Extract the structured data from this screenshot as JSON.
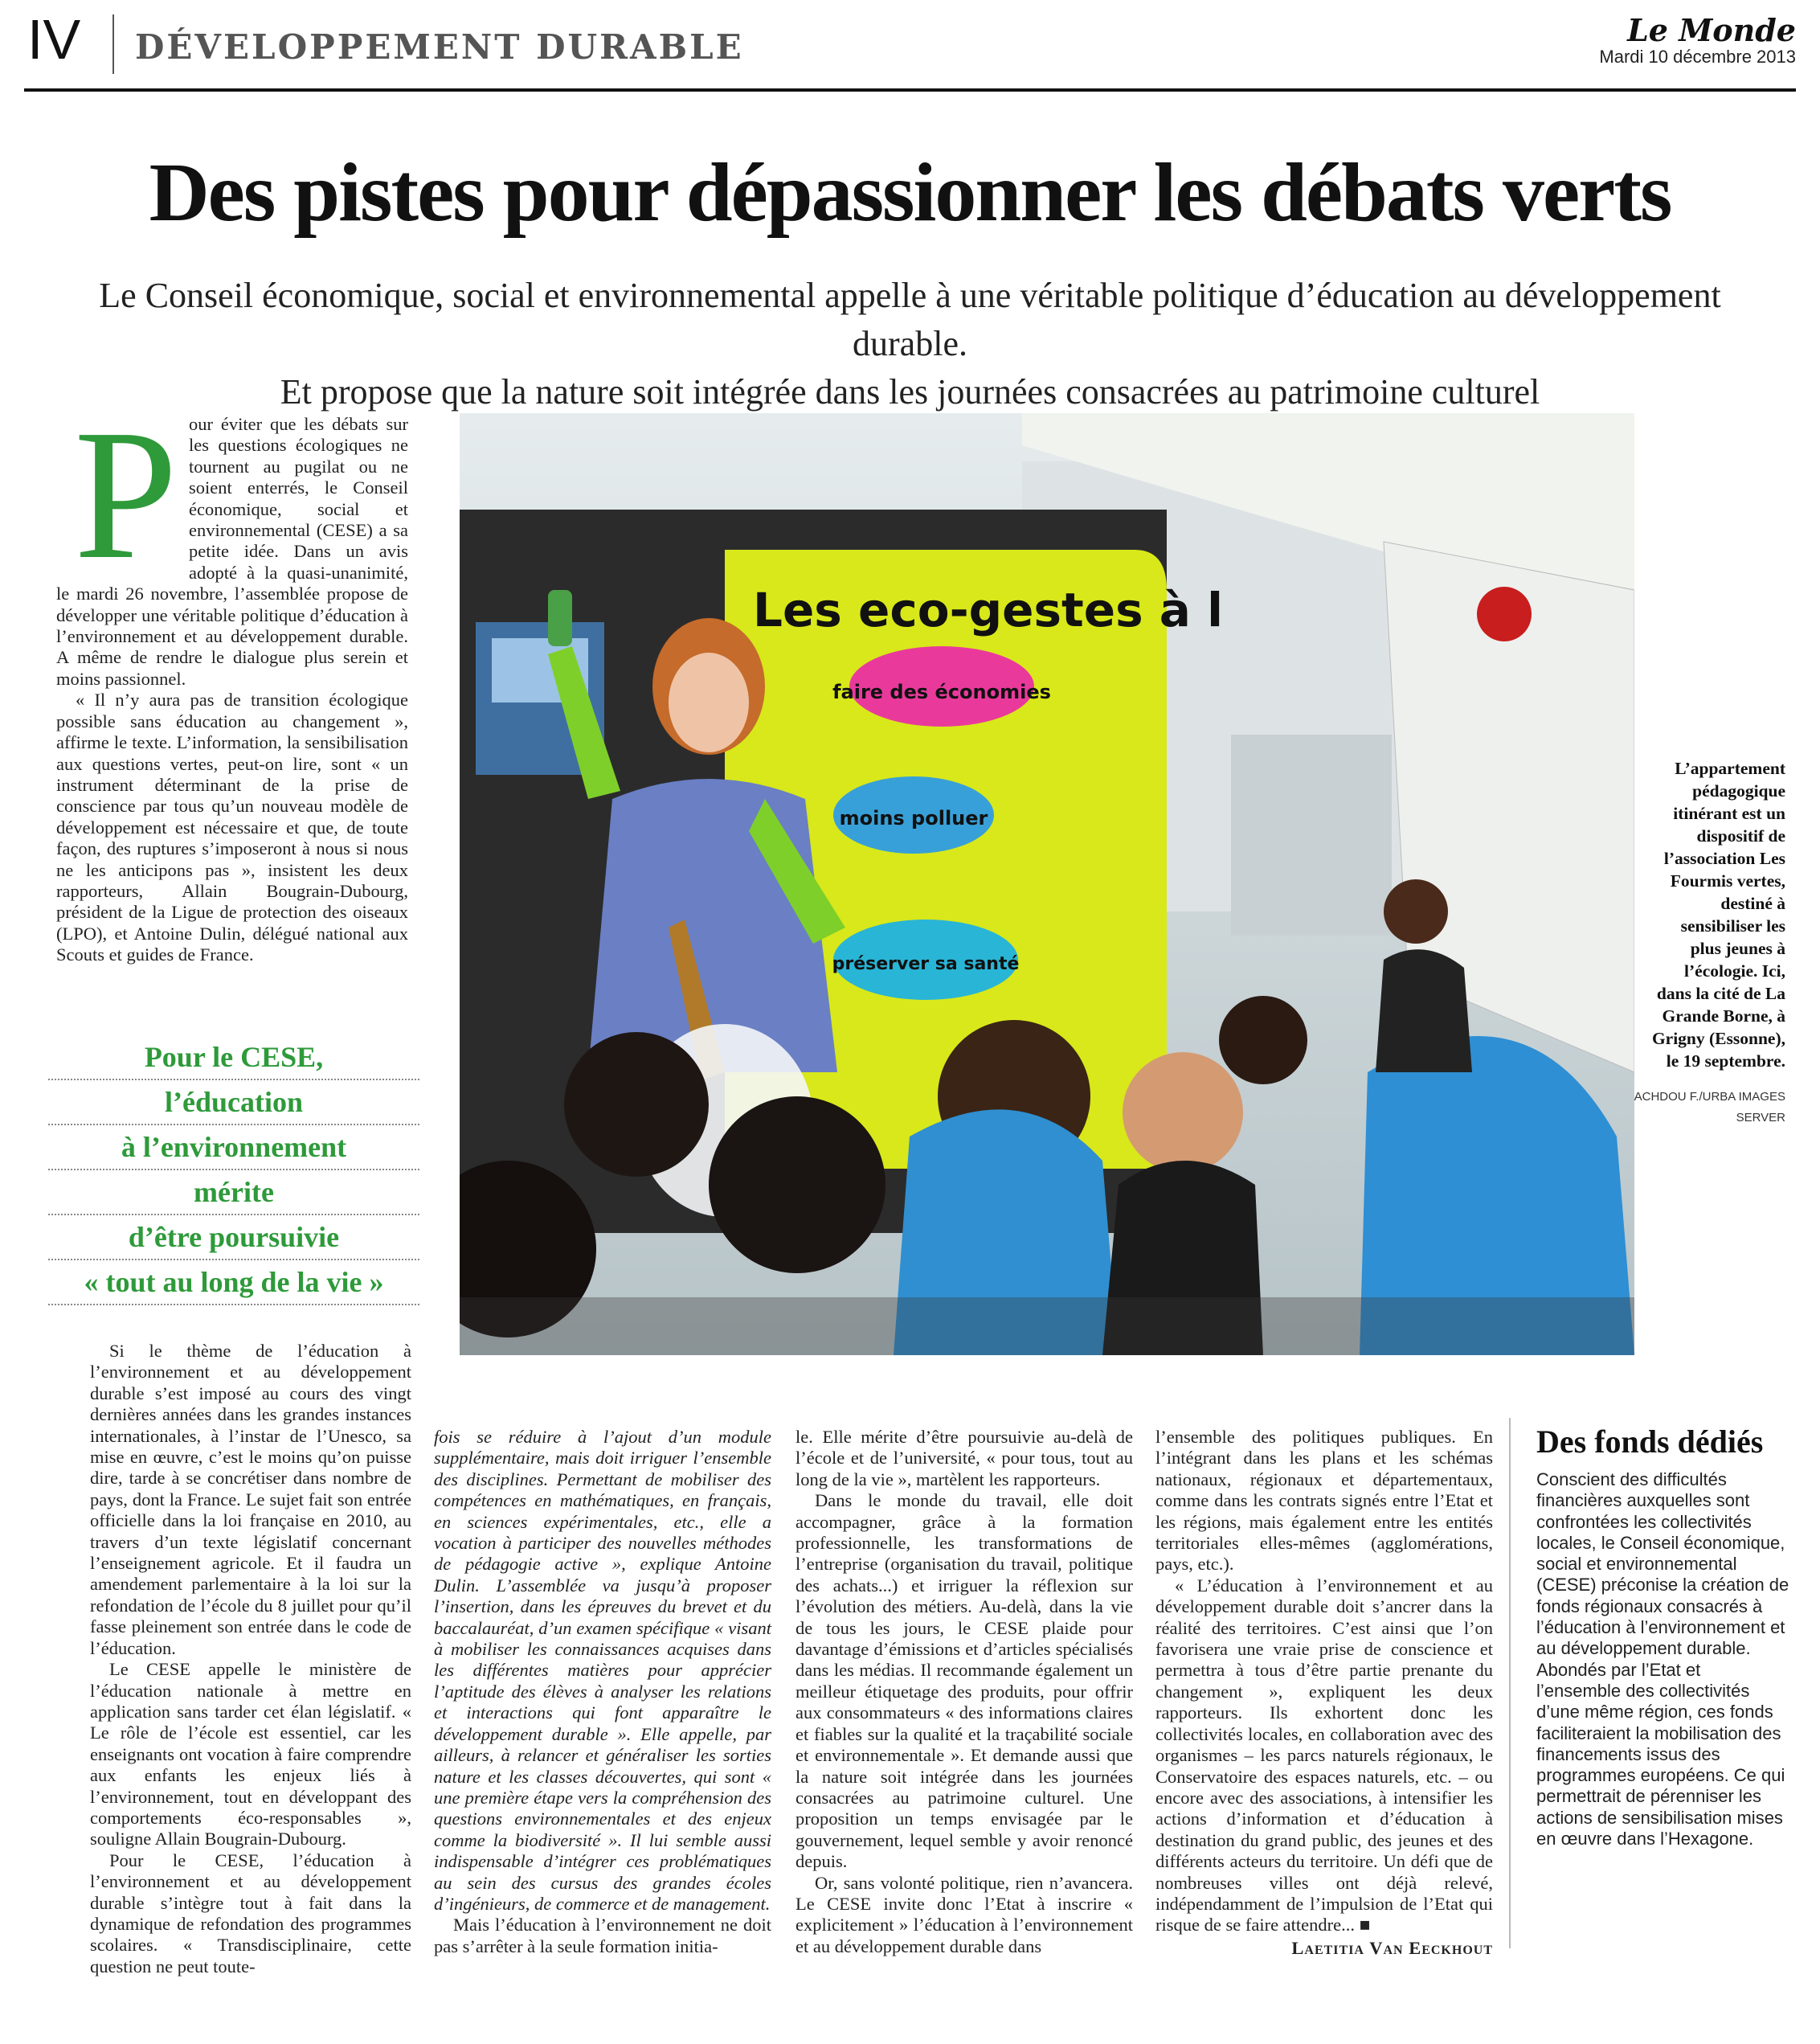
{
  "header": {
    "page_number": "IV",
    "section": "DÉVELOPPEMENT DURABLE",
    "newspaper": "Le Monde",
    "date": "Mardi 10 décembre 2013"
  },
  "article": {
    "headline": "Des pistes pour dépassionner les débats verts",
    "subhead_line1": "Le Conseil économique, social et environnemental appelle à une véritable politique d’éducation au développement durable.",
    "subhead_line2": "Et propose que la nature soit intégrée dans les journées consacrées au patrimoine culturel",
    "dropcap": "P",
    "intro_p1": "our éviter que les débats sur les questions écologiques ne tournent au pugilat ou ne soient enterrés, le Conseil économique, social et environnemental (CESE) a sa petite idée. Dans un avis adopté à la quasi-unanimité, le mardi 26 novembre, l’assemblée propose de développer une véritable politique d’éducation à l’environnement et au développement durable. A même de rendre le dialogue plus serein et moins passionnel.",
    "intro_p2": "« Il n’y aura pas de transition écologique possible sans éducation au changement », affirme le texte. L’information, la sensibilisation aux questions vertes, peut-on lire, sont « un instrument déterminant de la prise de conscience par tous qu’un nouveau modèle de développement est nécessaire et que, de toute façon, des ruptures s’imposeront à nous si nous ne les anticipons pas », insistent les deux rapporteurs, Allain Bougrain-Dubourg, président de la Ligue de protection des oiseaux (LPO), et Antoine Dulin, délégué national aux Scouts et guides de France.",
    "pullquote": [
      "Pour le CESE,",
      "l’éducation",
      "à l’environnement",
      "mérite",
      "d’être poursuivie",
      "« tout au long de la vie »"
    ],
    "col1_p1": "Si le thème de l’éducation à l’environnement et au développement durable s’est imposé au cours des vingt dernières années dans les grandes instances internationales, à l’instar de l’Unesco, sa mise en œuvre, c’est le moins qu’on puisse dire, tarde à se concrétiser dans nombre de pays, dont la France. Le sujet fait son entrée officielle dans la loi française en 2010, au travers d’un texte législatif concernant l’enseignement agricole. Et il faudra un amendement parlementaire à la loi sur la refondation de l’école du 8 juillet pour qu’il fasse pleinement son entrée dans le code de l’éducation.",
    "col1_p2": "Le CESE appelle le ministère de l’éducation nationale à mettre en application sans tarder cet élan législatif. « Le rôle de l’école est essentiel, car les enseignants ont vocation à faire comprendre aux enfants les enjeux liés à l’environnement, tout en développant des comportements éco-responsables », souligne Allain Bougrain-Dubourg.",
    "col1_p3": "Pour le CESE, l’éducation à l’environnement et au développement durable s’intègre tout à fait dans la dynamique de refondation des programmes scolaires. « Transdisciplinaire, cette question ne peut toute-",
    "col2_p1": "fois se réduire à l’ajout d’un module supplémentaire, mais doit irriguer l’ensemble des disciplines. Permettant de mobiliser des compétences en mathématiques, en français, en sciences expérimentales, etc., elle a vocation à participer des nouvelles méthodes de pédagogie active », explique Antoine Dulin. L’assemblée va jusqu’à proposer l’insertion, dans les épreuves du brevet et du baccalauréat, d’un examen spécifique « visant à mobiliser les connaissances acquises dans les différentes matières pour apprécier l’aptitude des élèves à analyser les relations et interactions qui font apparaître le développement durable ». Elle appelle, par ailleurs, à relancer et généraliser les sorties nature et les classes découvertes, qui sont « une première étape vers la compréhension des questions environnementales et des enjeux comme la biodiversité ». Il lui semble aussi indispensable d’intégrer ces problématiques au sein des cursus des grandes écoles d’ingénieurs, de commerce et de management.",
    "col2_p2": "Mais l’éducation à l’environnement ne doit pas s’arrêter à la seule formation initia-",
    "col3_p1": "le. Elle mérite d’être poursuivie au-delà de l’école et de l’université, « pour tous, tout au long de la vie », martèlent les rapporteurs.",
    "col3_p2": "Dans le monde du travail, elle doit accompagner, grâce à la formation professionnelle, les transformations de l’entreprise (organisation du travail, politique des achats...) et irriguer la réflexion sur l’évolution des métiers. Au-delà, dans la vie de tous les jours, le CESE plaide pour davantage d’émissions et d’articles spécialisés dans les médias. Il recommande également un meilleur étiquetage des produits, pour offrir aux consommateurs « des informations claires et fiables sur la qualité et la traçabilité sociale et environnementale ». Et demande aussi que la nature soit intégrée dans les journées consacrées au patrimoine culturel. Une proposition un temps envisagée par le gouvernement, lequel semble y avoir renoncé depuis.",
    "col3_p3": "Or, sans volonté politique, rien n’avancera. Le CESE invite donc l’Etat à inscrire « explicitement » l’éducation à l’environnement et au développement durable dans",
    "col4_p1": "l’ensemble des politiques publiques. En l’intégrant dans les plans et les schémas nationaux, régionaux et départementaux, comme dans les contrats signés entre l’Etat et les régions, mais également entre les entités territoriales elles-mêmes (agglomérations, pays, etc.).",
    "col4_p2": "« L’éducation à l’environnement et au développement durable doit s’ancrer dans la réalité des territoires. C’est ainsi que l’on favorisera une vraie prise de conscience et permettra à tous d’être partie prenante du changement », expliquent les deux rapporteurs. Ils exhortent donc les collectivités locales, en collaboration avec des organismes – les parcs naturels régionaux, le Conservatoire des espaces naturels, etc. – ou encore avec des associations, à intensifier les actions d’information et d’éducation à destination du grand public, des jeunes et des différents acteurs du territoire. Un défi que de nombreuses villes ont déjà relevé, indépendamment de l’impulsion de l’Etat qui risque de se faire attendre... ■",
    "author": "Laetitia Van Eeckhout"
  },
  "photo": {
    "van_text": "Les eco-gestes à l",
    "badge1": "faire des économies",
    "badge2": "moins polluer",
    "badge3": "préserver sa santé",
    "caption": "L’appartement pédagogique itinérant est un dispositif de l’association Les Fourmis vertes, destiné à sensibiliser les plus jeunes à l’écologie. Ici, dans la cité de La Grande Borne, à Grigny (Essonne), le 19 septembre.",
    "credit": "ACHDOU F./URBA IMAGES SERVER"
  },
  "sidebar": {
    "title": "Des fonds dédiés",
    "p1": "Conscient des difficultés financières auxquelles sont confrontées les collectivités locales, le Conseil économique, social et environnemental (CESE) préconise la création de fonds régionaux consacrés à l’éducation à l’environnement et au développement durable.",
    "p2": "Abondés par l’Etat et l’ensemble des collectivités d’une même région, ces fonds faciliteraient la mobilisation des financements issus des programmes européens. Ce qui permettrait de pérenniser les actions de sensibilisation mises en œuvre dans l’Hexagone."
  },
  "colors": {
    "accent_green": "#2e9a3a",
    "van_yellow": "#d8e81a"
  }
}
